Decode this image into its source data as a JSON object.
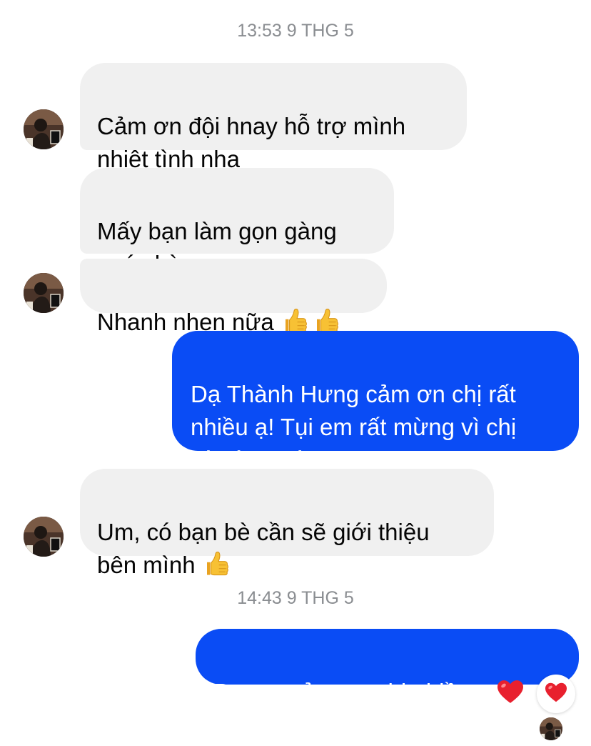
{
  "thread": {
    "timestamp_1": "13:53 9 THG 5",
    "timestamp_2": "14:43 9 THG 5",
    "messages": [
      {
        "sender": "contact",
        "text": "Cảm ơn đội hnay hỗ trợ mình\nnhiệt tình nha"
      },
      {
        "sender": "contact",
        "text": "Mấy bạn làm gọn gàng\nquá chừng"
      },
      {
        "sender": "contact",
        "text": "Nhanh nhẹn nữa",
        "emojis": [
          "thumbs-up",
          "thumbs-up"
        ]
      },
      {
        "sender": "me",
        "text": "Dạ Thành Hưng cảm ơn chị rất\nnhiều ạ! Tụi em rất mừng vì chị\nhài lòng với dịch vụ"
      },
      {
        "sender": "contact",
        "text": "Um, có bạn bè cần sẽ giới thiệu\nbên mình",
        "emojis": [
          "thumbs-up"
        ]
      },
      {
        "sender": "me",
        "text": "Dạ em cảm ơn chị nhiều ạ",
        "emojis": [
          "red-heart"
        ],
        "reaction": "red-heart"
      }
    ]
  },
  "colors": {
    "incoming_bubble": "#f0f0f0",
    "outgoing_bubble": "#0a4cf5",
    "timestamp_text": "#8a8d91",
    "heart": "#e8202e",
    "thumb": "#f7c134"
  }
}
